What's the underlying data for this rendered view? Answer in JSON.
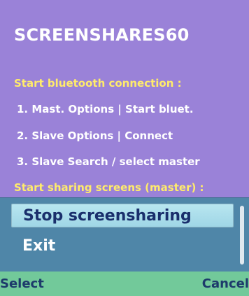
{
  "app": {
    "title": "SCREENSHARES60"
  },
  "instructions": {
    "bt_header": "Start bluetooth connection :",
    "steps": [
      "1. Mast.  Options | Start bluet.",
      "2. Slave  Options | Connect",
      "3. Slave  Search / select master"
    ],
    "share_header": "Start sharing screens (master) :"
  },
  "options_menu": {
    "items": [
      {
        "label": "Stop screensharing",
        "selected": true
      },
      {
        "label": "Exit",
        "selected": false
      }
    ]
  },
  "softkeys": {
    "left": "Select",
    "right": "Cancel"
  },
  "colors": {
    "background": "#9a82d8",
    "title_text": "#ffffff",
    "header_text": "#ffeb6b",
    "menu_panel": "#4f86a8",
    "menu_highlight": "#b8e6f0",
    "softkey_bar": "#72c99a",
    "softkey_text": "#1d3a6b"
  }
}
